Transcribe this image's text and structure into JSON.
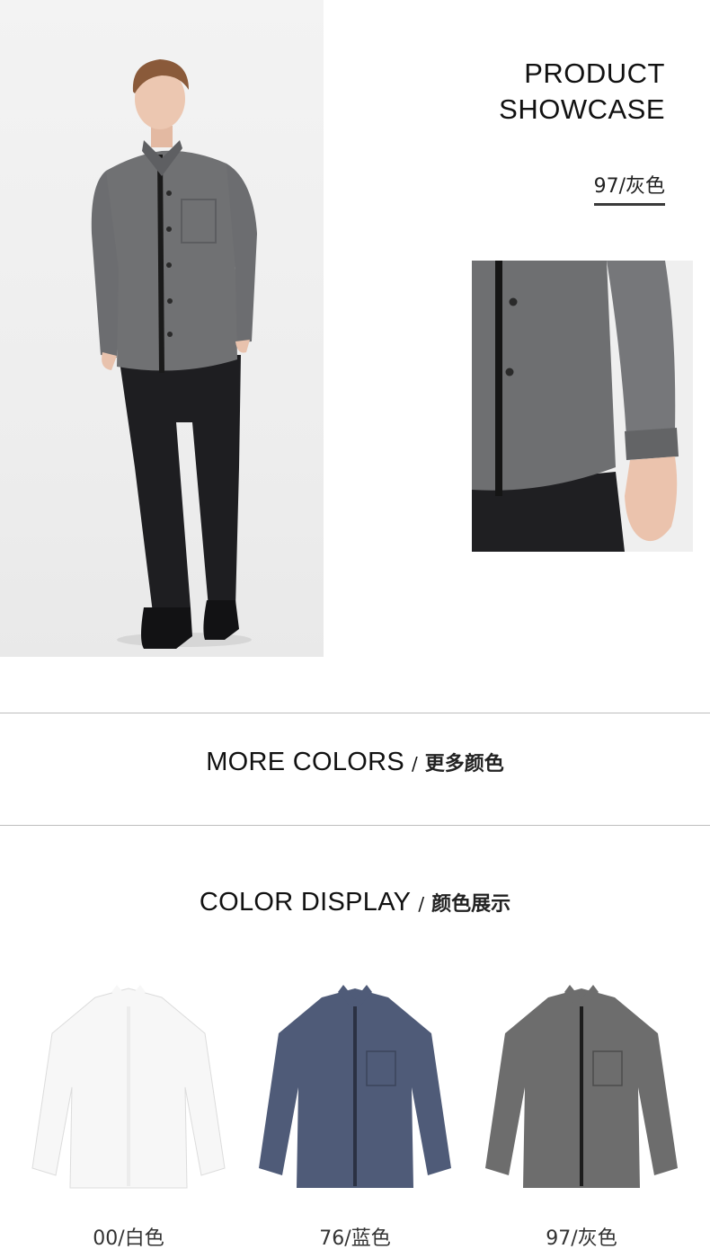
{
  "showcase": {
    "title_line1": "PRODUCT",
    "title_line2": "SHOWCASE",
    "color_code": "97/灰色"
  },
  "more_colors": {
    "en": "MORE COLORS",
    "separator": "/",
    "cn": "更多颜色"
  },
  "color_display": {
    "en": "COLOR DISPLAY",
    "separator": "/",
    "cn": "颜色展示"
  },
  "swatches": [
    {
      "label": "00/白色",
      "color": "#f7f7f7",
      "placket": "#ececec"
    },
    {
      "label": "76/蓝色",
      "color": "#4f5b78",
      "placket": "#2b3143"
    },
    {
      "label": "97/灰色",
      "color": "#6d6d6d",
      "placket": "#1c1c1c"
    }
  ],
  "colors": {
    "shirt_grey": "#6f7072",
    "trousers": "#1d1d20",
    "background": "#f0f0f0"
  }
}
